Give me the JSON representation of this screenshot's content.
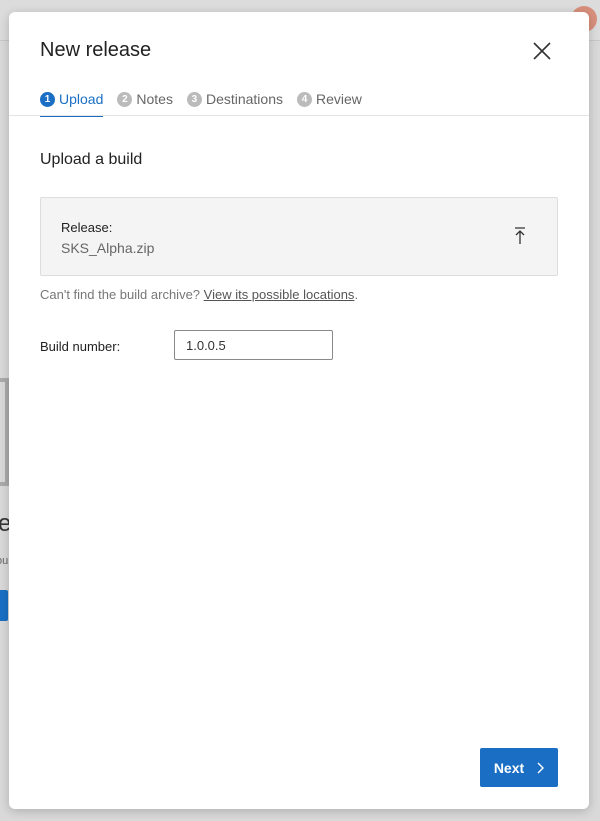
{
  "dialog": {
    "title": "New release",
    "close_icon": "close-icon",
    "steps": [
      {
        "num": "1",
        "label": "Upload",
        "active": true
      },
      {
        "num": "2",
        "label": "Notes",
        "active": false
      },
      {
        "num": "3",
        "label": "Destinations",
        "active": false
      },
      {
        "num": "4",
        "label": "Review",
        "active": false
      }
    ],
    "section_title": "Upload a build",
    "upload": {
      "label": "Release:",
      "filename": "SKS_Alpha.zip",
      "icon": "upload-icon"
    },
    "hint": {
      "text": "Can't find the build archive? ",
      "link": "View its possible locations",
      "suffix": "."
    },
    "build_number": {
      "label": "Build number:",
      "value": "1.0.0.5"
    },
    "next_label": "Next"
  },
  "background": {
    "heading_fragment": "e",
    "text_fragment": "ou"
  },
  "colors": {
    "accent": "#1a6fc4"
  }
}
